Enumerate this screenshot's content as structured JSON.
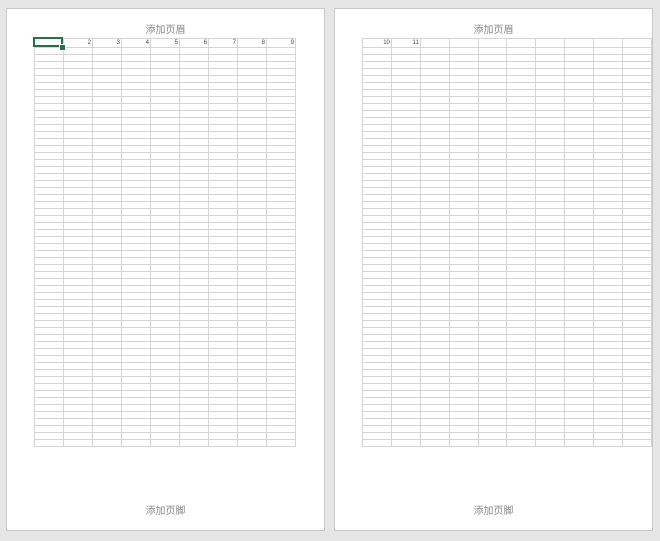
{
  "pages": [
    {
      "header_label": "添加页眉",
      "footer_label": "添加页脚",
      "column_numbers": [
        "",
        "2",
        "3",
        "4",
        "5",
        "6",
        "7",
        "8",
        "9"
      ]
    },
    {
      "header_label": "添加页眉",
      "footer_label": "添加页脚",
      "column_numbers": [
        "10",
        "11",
        "",
        "",
        "",
        "",
        "",
        "",
        "",
        ""
      ]
    }
  ],
  "colors": {
    "selection": "#217346",
    "gridline": "#d4d4d4",
    "background": "#e6e6e6"
  }
}
